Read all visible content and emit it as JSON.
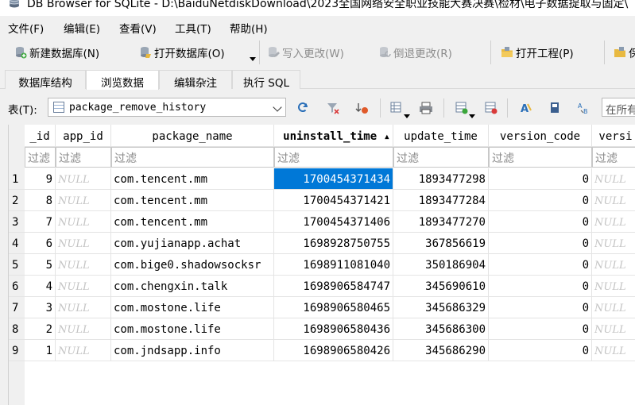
{
  "window": {
    "title": "DB Browser for SQLite - D:\\BaiduNetdiskDownload\\2023全国网络安全职业技能大赛决赛\\检材\\电子数据提取与固定\\"
  },
  "menu": {
    "items": [
      "文件(F)",
      "编辑(E)",
      "查看(V)",
      "工具(T)",
      "帮助(H)"
    ]
  },
  "toolbar": {
    "new_db": "新建数据库(N)",
    "open_db": "打开数据库(O)",
    "write_changes": "写入更改(W)",
    "revert_changes": "倒退更改(R)",
    "open_project": "打开工程(P)",
    "save_project": "保"
  },
  "tabs": [
    "数据库结构",
    "浏览数据",
    "编辑杂注",
    "执行 SQL"
  ],
  "active_tab": "浏览数据",
  "browse": {
    "table_label": "表(T):",
    "table_name": "package_remove_history",
    "filter_all_placeholder": "在所有"
  },
  "grid": {
    "columns": [
      "_id",
      "app_id",
      "package_name",
      "uninstall_time",
      "update_time",
      "version_code",
      "versi"
    ],
    "filter_placeholder": "过滤",
    "null_text": "NULL",
    "rows": [
      {
        "num": "1",
        "id": "9",
        "package_name": "com.tencent.mm",
        "uninstall_time": "1700454371434",
        "update_time": "1893477298",
        "version_code": "0"
      },
      {
        "num": "2",
        "id": "8",
        "package_name": "com.tencent.mm",
        "uninstall_time": "1700454371421",
        "update_time": "1893477284",
        "version_code": "0"
      },
      {
        "num": "3",
        "id": "7",
        "package_name": "com.tencent.mm",
        "uninstall_time": "1700454371406",
        "update_time": "1893477270",
        "version_code": "0"
      },
      {
        "num": "4",
        "id": "6",
        "package_name": "com.yujianapp.achat",
        "uninstall_time": "1698928750755",
        "update_time": "367856619",
        "version_code": "0"
      },
      {
        "num": "5",
        "id": "5",
        "package_name": "com.bige0.shadowsocksr",
        "uninstall_time": "1698911081040",
        "update_time": "350186904",
        "version_code": "0"
      },
      {
        "num": "6",
        "id": "4",
        "package_name": "com.chengxin.talk",
        "uninstall_time": "1698906584747",
        "update_time": "345690610",
        "version_code": "0"
      },
      {
        "num": "7",
        "id": "3",
        "package_name": "com.mostone.life",
        "uninstall_time": "1698906580465",
        "update_time": "345686329",
        "version_code": "0"
      },
      {
        "num": "8",
        "id": "2",
        "package_name": "com.mostone.life",
        "uninstall_time": "1698906580436",
        "update_time": "345686300",
        "version_code": "0"
      },
      {
        "num": "9",
        "id": "1",
        "package_name": "com.jndsapp.info",
        "uninstall_time": "1698906580426",
        "update_time": "345686290",
        "version_code": "0"
      }
    ],
    "selected": {
      "row": 0,
      "column": "uninstall_time"
    }
  },
  "colors": {
    "selection": "#0078d7",
    "null_text": "#c4c4c4",
    "window_bg": "#f0f0f0"
  }
}
